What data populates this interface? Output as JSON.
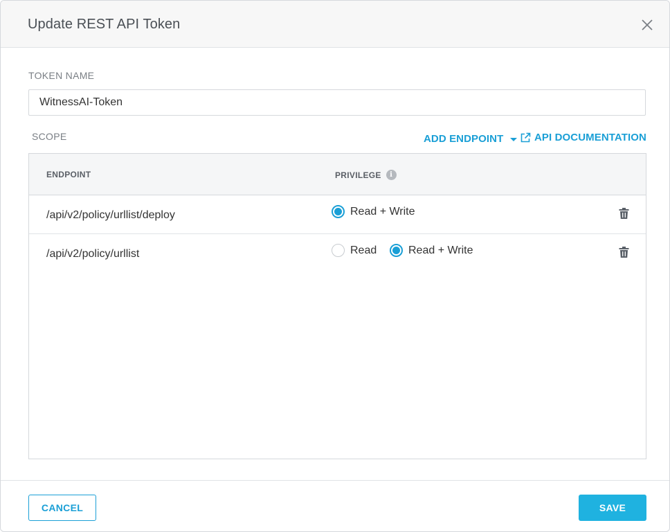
{
  "dialog": {
    "title": "Update REST API Token"
  },
  "token": {
    "label": "TOKEN NAME",
    "value": "WitnessAI-Token"
  },
  "scope": {
    "label": "SCOPE",
    "add_endpoint_label": "ADD ENDPOINT",
    "api_docs_label": "API DOCUMENTATION"
  },
  "table": {
    "headers": {
      "endpoint": "ENDPOINT",
      "privilege": "PRIVILEGE"
    },
    "rows": [
      {
        "endpoint": "/api/v2/policy/urllist/deploy",
        "options": [
          {
            "label": "Read + Write",
            "checked": true
          }
        ]
      },
      {
        "endpoint": "/api/v2/policy/urllist",
        "options": [
          {
            "label": "Read",
            "checked": false
          },
          {
            "label": "Read + Write",
            "checked": true
          }
        ]
      }
    ]
  },
  "footer": {
    "cancel_label": "CANCEL",
    "save_label": "SAVE"
  },
  "colors": {
    "accent": "#1a9fd6",
    "save_bg": "#1fb2e0",
    "header_bg": "#f7f7f7"
  },
  "icons": {
    "close": "close-icon",
    "caret": "caret-down-icon",
    "external_link": "external-link-icon",
    "info": "info-icon",
    "trash": "trash-icon"
  }
}
